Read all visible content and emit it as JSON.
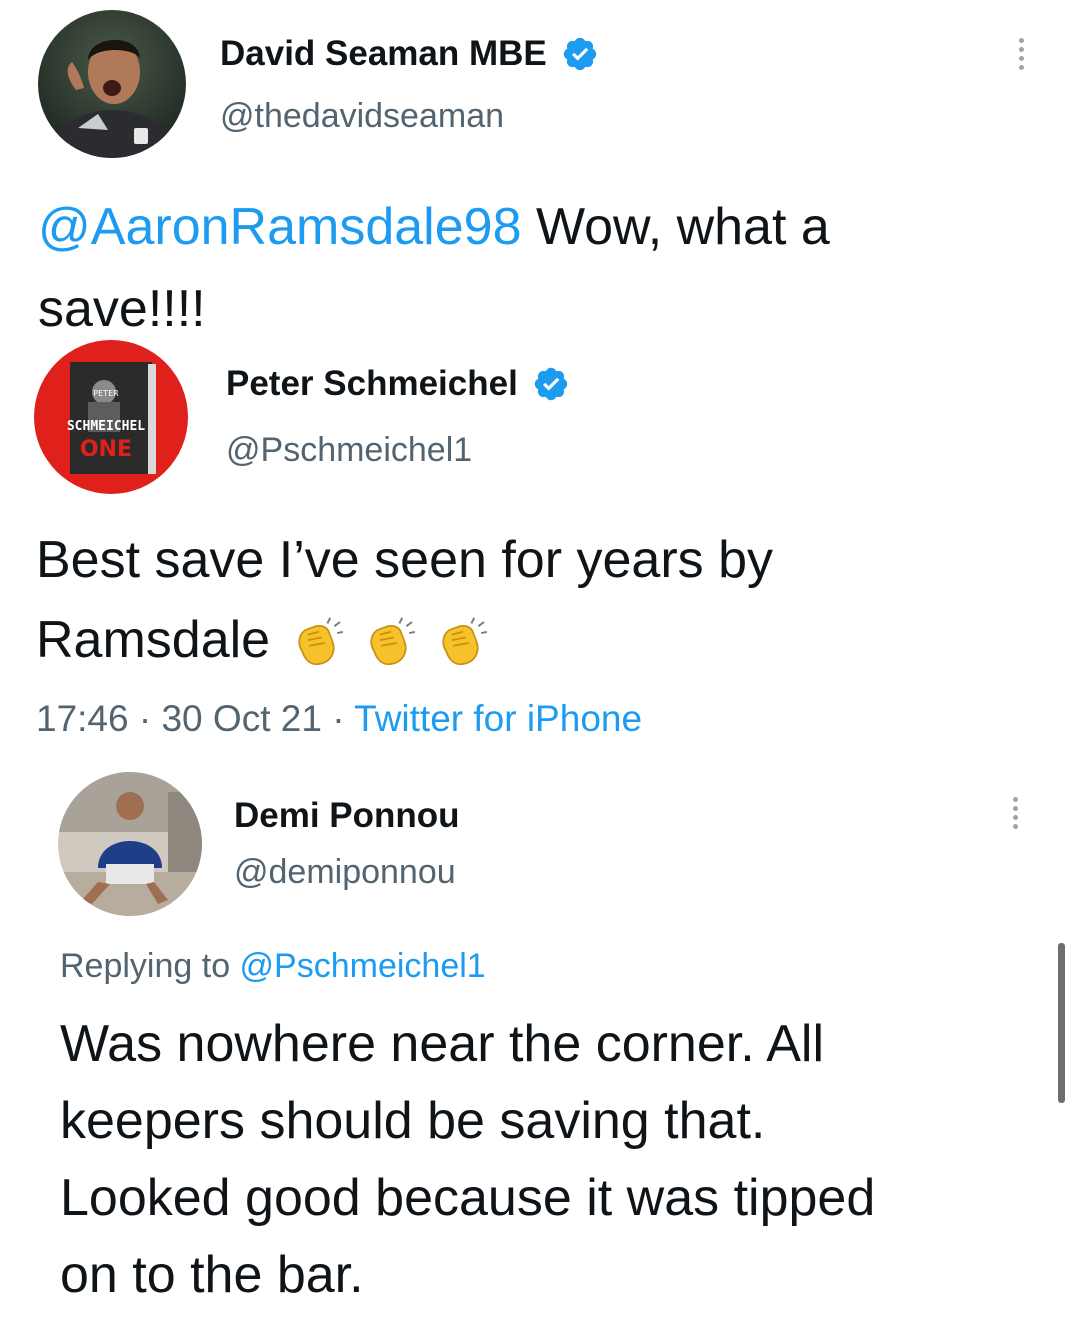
{
  "tweets": [
    {
      "name": "David Seaman MBE",
      "handle": "@thedavidseaman",
      "mention": "@AaronRamsdale98",
      "text_line1": " Wow, what a",
      "text_line2": "save!!!!",
      "avatar": "goalkeeper-photo"
    },
    {
      "name": "Peter Schmeichel",
      "handle": "@Pschmeichel1",
      "text_line1": "Best save I’ve seen for years by",
      "text_line2": "Ramsdale",
      "emoji": [
        "clapping-hands",
        "clapping-hands",
        "clapping-hands"
      ],
      "time": "17:46",
      "sep1": " · ",
      "date": "30 Oct 21",
      "sep2": " · ",
      "source": "Twitter for iPhone",
      "avatar_book_text": [
        "PETER",
        "SCHMEICHEL",
        "ONE"
      ]
    },
    {
      "name": "Demi Ponnou",
      "handle": "@demiponnou",
      "replying_prefix": "Replying to ",
      "replying_handle": "@Pschmeichel1",
      "lines": [
        "Was nowhere near the corner. All",
        "keepers should be saving that.",
        "Looked good because it was tipped",
        "on to the bar."
      ],
      "avatar": "man-seated-photo"
    }
  ],
  "colors": {
    "accent": "#1d9bf0",
    "text": "#0f1419",
    "secondary": "#536471",
    "avatar_red": "#e0201b"
  }
}
